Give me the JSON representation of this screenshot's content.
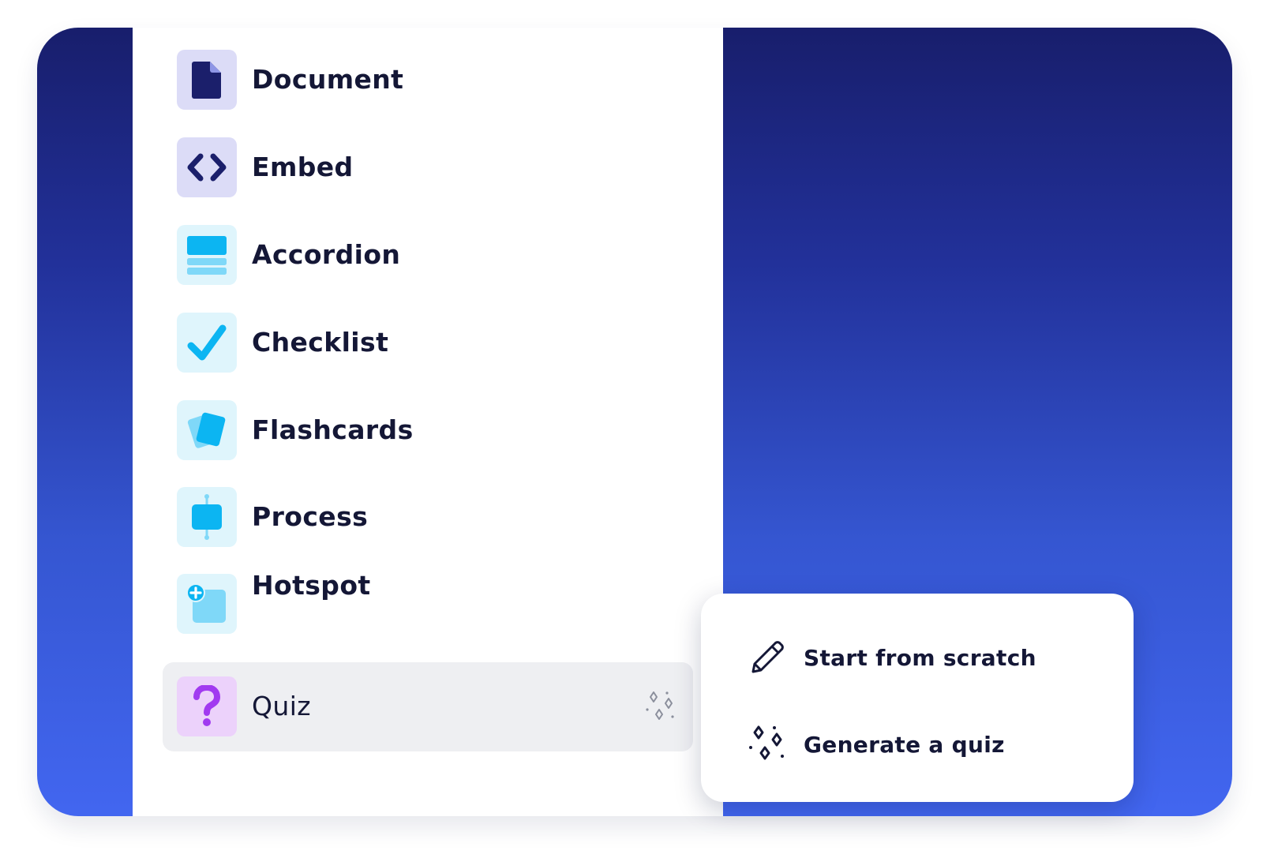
{
  "block_menu": {
    "items": [
      {
        "label": "Document",
        "icon": "document-icon"
      },
      {
        "label": "Embed",
        "icon": "embed-code-icon"
      },
      {
        "label": "Accordion",
        "icon": "accordion-icon"
      },
      {
        "label": "Checklist",
        "icon": "checkmark-icon"
      },
      {
        "label": "Flashcards",
        "icon": "flashcards-icon"
      },
      {
        "label": "Process",
        "icon": "process-icon"
      },
      {
        "label": "Hotspot",
        "icon": "hotspot-icon"
      },
      {
        "label": "Quiz",
        "icon": "question-mark-icon",
        "selected": true,
        "badge_icon": "sparkles-icon"
      }
    ]
  },
  "quiz_popover": {
    "items": [
      {
        "label": "Start from scratch",
        "icon": "pencil-icon"
      },
      {
        "label": "Generate a quiz",
        "icon": "sparkles-icon"
      }
    ]
  },
  "colors": {
    "background_gradient_top": "#181e6c",
    "background_gradient_bottom": "#4266f0",
    "indigo_icon": "#1b1f6b",
    "cyan_icon": "#0cb5f2",
    "purple_icon": "#a13af0",
    "selected_row": "#eeeff2"
  }
}
